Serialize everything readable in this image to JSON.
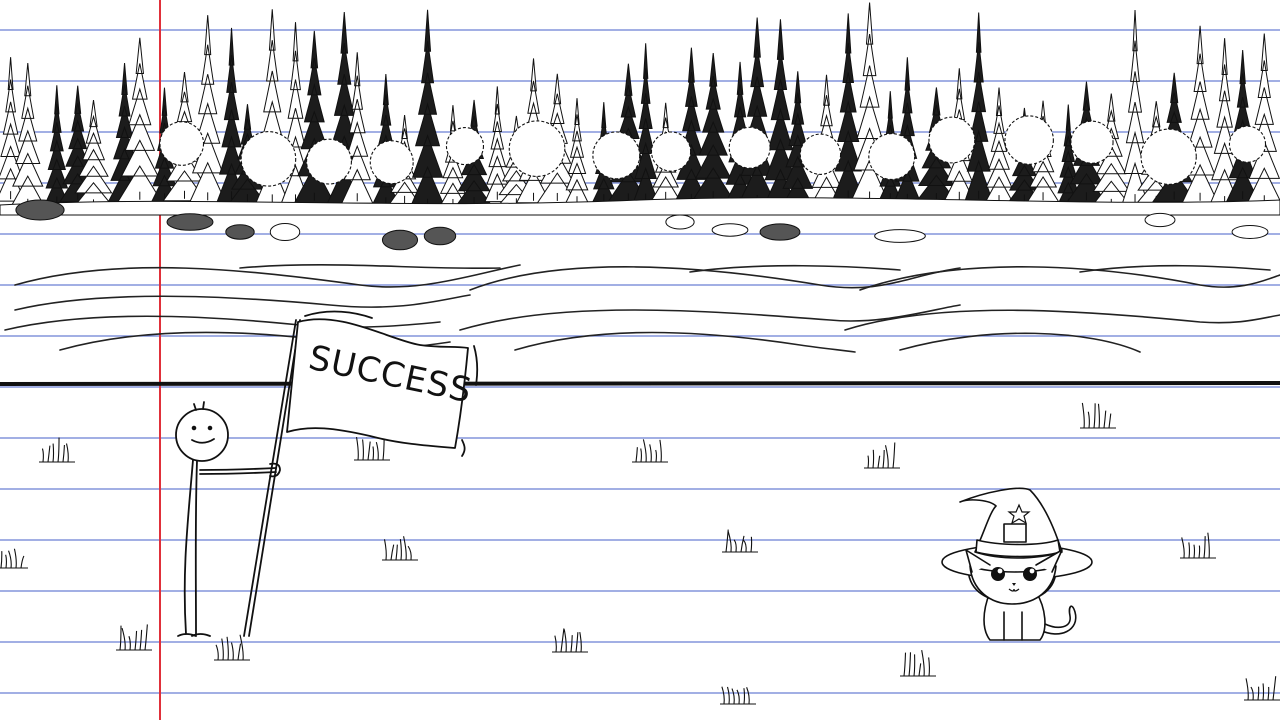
{
  "scene": {
    "flag_text": "SUCCESS",
    "paper": {
      "background": "#ffffff",
      "rule_color": "#6b7fd4",
      "margin_color": "#e0303a"
    },
    "ink_color": "#111111",
    "characters": [
      {
        "name": "stick-figure",
        "holds": "flag"
      },
      {
        "name": "cat",
        "wears": "witch-hat"
      }
    ]
  }
}
